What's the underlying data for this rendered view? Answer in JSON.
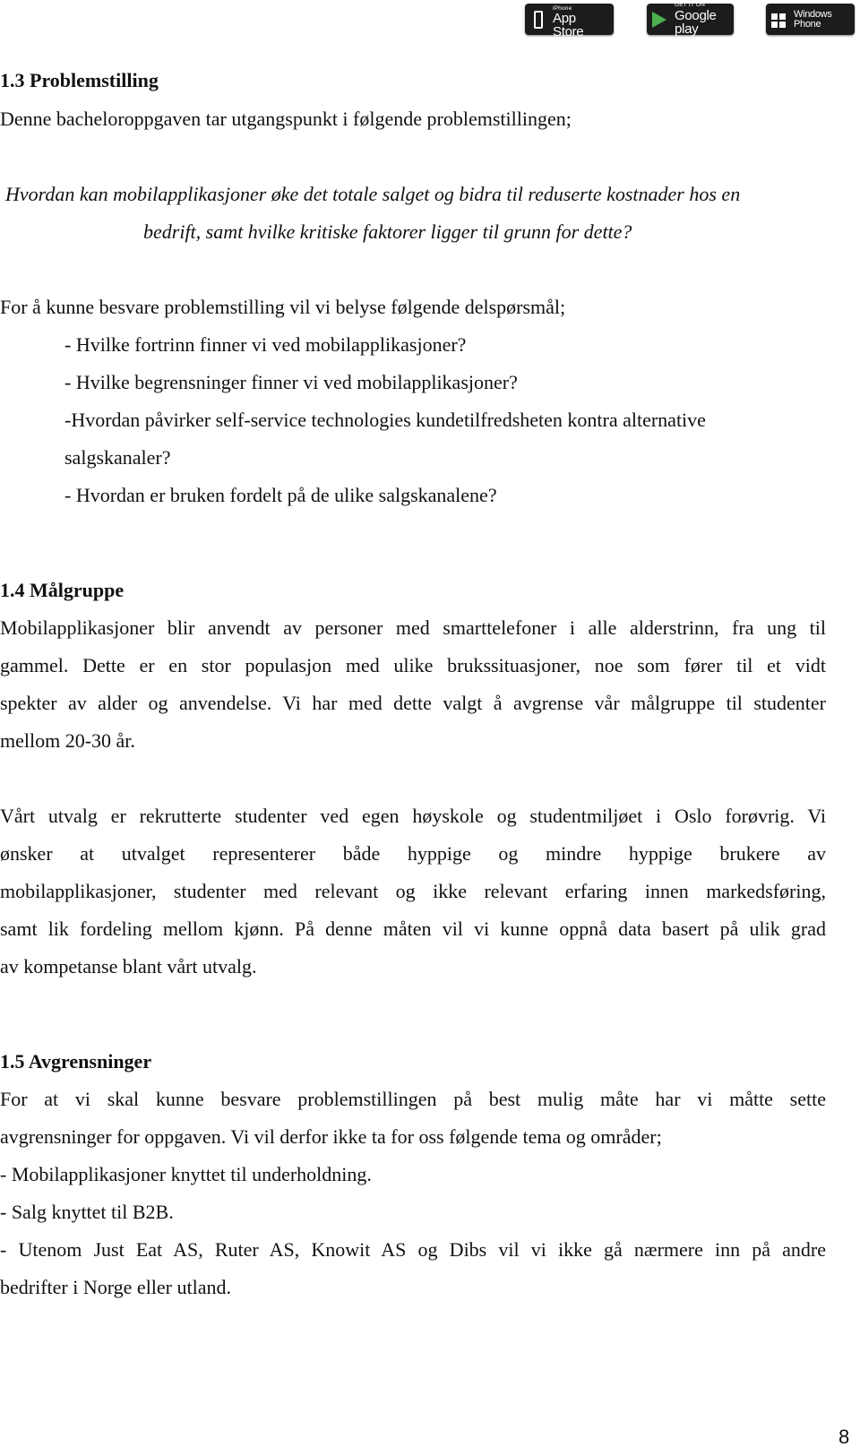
{
  "header": {
    "badges": [
      {
        "icon": "iphone-icon",
        "small": "Available on the iPhone",
        "big": "App Store"
      },
      {
        "icon": "google-play-icon",
        "small": "GET IT ON",
        "big": "Google play"
      },
      {
        "icon": "windows-icon",
        "big1": "Windows",
        "big2": "Phone"
      }
    ]
  },
  "section_1_3": {
    "heading": "1.3 Problemstilling",
    "intro": "Denne bacheloroppgaven tar utgangspunkt i følgende problemstillingen;",
    "question_line1": "Hvordan kan mobilapplikasjoner øke det totale salget og bidra til reduserte kostnader hos en",
    "question_line2": "bedrift, samt hvilke kritiske faktorer ligger til grunn for dette?",
    "sub_intro": "For å kunne besvare problemstilling vil vi belyse følgende delspørsmål;",
    "sub_questions": [
      "- Hvilke fortrinn finner vi ved mobilapplikasjoner?",
      "- Hvilke begrensninger finner vi ved mobilapplikasjoner?",
      "-Hvordan påvirker self-service technologies kundetilfredsheten kontra alternative",
      "salgskanaler?",
      "- Hvordan er bruken fordelt på de ulike salgskanalene?"
    ]
  },
  "section_1_4": {
    "heading": "1.4 Målgruppe",
    "para1": [
      "Mobilapplikasjoner blir anvendt av personer med smarttelefoner i alle alderstrinn, fra ung til",
      "gammel. Dette er en stor populasjon med ulike brukssituasjoner, noe som fører til et vidt",
      "spekter av alder og anvendelse. Vi har med dette valgt å avgrense vår målgruppe til studenter",
      "mellom 20-30 år."
    ],
    "para2": [
      "Vårt utvalg er rekrutterte studenter ved egen høyskole og studentmiljøet i Oslo forøvrig. Vi",
      "ønsker at utvalget representerer både hyppige og mindre hyppige brukere av",
      "mobilapplikasjoner, studenter med relevant og ikke relevant erfaring innen markedsføring,",
      "samt lik fordeling mellom kjønn. På denne måten vil vi kunne oppnå data basert på ulik grad",
      "av kompetanse blant vårt utvalg."
    ]
  },
  "section_1_5": {
    "heading": "1.5 Avgrensninger",
    "lines": [
      "For at vi skal kunne besvare problemstillingen på best mulig måte har vi måtte sette",
      "avgrensninger for oppgaven. Vi vil derfor ikke ta for oss følgende tema og områder;",
      "- Mobilapplikasjoner knyttet til underholdning.",
      "- Salg knyttet til B2B.",
      "- Utenom Just Eat AS, Ruter AS, Knowit AS og Dibs vil vi ikke gå nærmere inn på andre",
      "bedrifter i Norge eller utland."
    ]
  },
  "footer": {
    "page_number": "8"
  }
}
